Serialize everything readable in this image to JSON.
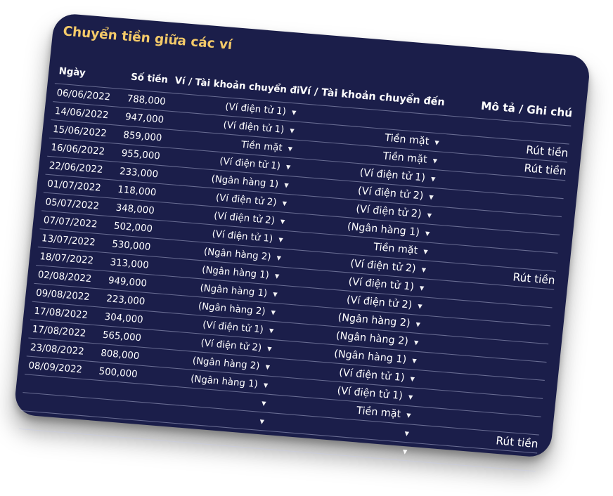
{
  "title": "Chuyển tiền giữa các ví",
  "headers": {
    "date": "Ngày",
    "amount": "Số tiền",
    "from": "Ví / Tài khoản chuyển đi",
    "to": "Ví / Tài khoản chuyển đến",
    "note": "Mô tả / Ghi chú"
  },
  "dropdown_icon": "chevron-down-icon",
  "rows": [
    {
      "date": "06/06/2022",
      "amount": "788,000",
      "from": "(Ví điện tử 1)",
      "to": "",
      "note": ""
    },
    {
      "date": "14/06/2022",
      "amount": "947,000",
      "from": "(Ví điện tử 1)",
      "to": "Tiền mặt",
      "note": "Rút tiền"
    },
    {
      "date": "15/06/2022",
      "amount": "859,000",
      "from": "Tiền mặt",
      "to": "Tiền mặt",
      "note": "Rút tiền"
    },
    {
      "date": "16/06/2022",
      "amount": "955,000",
      "from": "(Ví điện tử 1)",
      "to": "(Ví điện tử 1)",
      "note": ""
    },
    {
      "date": "22/06/2022",
      "amount": "233,000",
      "from": "(Ngân hàng 1)",
      "to": "(Ví điện tử 2)",
      "note": ""
    },
    {
      "date": "01/07/2022",
      "amount": "118,000",
      "from": "(Ví điện tử 2)",
      "to": "(Ví điện tử 2)",
      "note": ""
    },
    {
      "date": "05/07/2022",
      "amount": "348,000",
      "from": "(Ví điện tử 2)",
      "to": "(Ngân hàng 1)",
      "note": ""
    },
    {
      "date": "07/07/2022",
      "amount": "502,000",
      "from": "(Ví điện tử 1)",
      "to": "Tiền mặt",
      "note": ""
    },
    {
      "date": "13/07/2022",
      "amount": "530,000",
      "from": "(Ngân hàng 2)",
      "to": "(Ví điện tử 2)",
      "note": "Rút tiền"
    },
    {
      "date": "18/07/2022",
      "amount": "313,000",
      "from": "(Ngân hàng 1)",
      "to": "(Ví điện tử 1)",
      "note": ""
    },
    {
      "date": "02/08/2022",
      "amount": "949,000",
      "from": "(Ngân hàng 1)",
      "to": "(Ví điện tử 2)",
      "note": ""
    },
    {
      "date": "09/08/2022",
      "amount": "223,000",
      "from": "(Ngân hàng 2)",
      "to": "(Ngân hàng 2)",
      "note": ""
    },
    {
      "date": "17/08/2022",
      "amount": "304,000",
      "from": "(Ví điện tử 1)",
      "to": "(Ngân hàng 2)",
      "note": ""
    },
    {
      "date": "17/08/2022",
      "amount": "565,000",
      "from": "(Ví điện tử 2)",
      "to": "(Ngân hàng 1)",
      "note": ""
    },
    {
      "date": "23/08/2022",
      "amount": "808,000",
      "from": "(Ngân hàng 2)",
      "to": "(Ví điện tử 1)",
      "note": ""
    },
    {
      "date": "08/09/2022",
      "amount": "500,000",
      "from": "(Ngân hàng 1)",
      "to": "(Ví điện tử 1)",
      "note": ""
    },
    {
      "date": "",
      "amount": "",
      "from": "",
      "to": "Tiền mặt",
      "note": ""
    },
    {
      "date": "",
      "amount": "",
      "from": "",
      "to": "",
      "note": "Rút tiền"
    },
    {
      "date": "",
      "amount": "",
      "from": "",
      "to": "",
      "note": ""
    }
  ],
  "arrows": {
    "from_rows": [
      0,
      1,
      2,
      3,
      4,
      5,
      6,
      7,
      8,
      9,
      10,
      11,
      12,
      13,
      14,
      15,
      16,
      17
    ],
    "to_rows": [
      1,
      2,
      3,
      4,
      5,
      6,
      7,
      8,
      9,
      10,
      11,
      12,
      13,
      14,
      15,
      16,
      17,
      18
    ]
  }
}
